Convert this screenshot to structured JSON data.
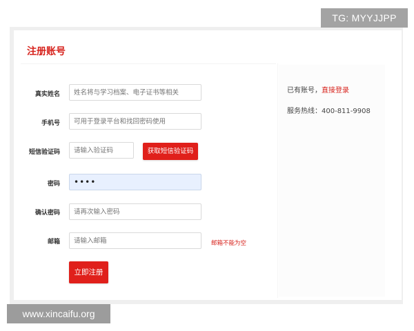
{
  "watermarks": {
    "top_right": "TG: MYYJJPP",
    "bottom_left": "www.xincaifu.org"
  },
  "form": {
    "title": "注册账号",
    "fields": {
      "real_name": {
        "label": "真实姓名",
        "placeholder": "姓名将与学习档案、电子证书等相关",
        "value": ""
      },
      "phone": {
        "label": "手机号",
        "placeholder": "可用于登录平台和找回密码使用",
        "value": ""
      },
      "sms_code": {
        "label": "短信验证码",
        "placeholder": "请输入验证码",
        "value": "",
        "button_label": "获取短信验证码"
      },
      "password": {
        "label": "密码",
        "placeholder": "",
        "value": "••••"
      },
      "confirm_password": {
        "label": "确认密码",
        "placeholder": "请再次输入密码",
        "value": ""
      },
      "email": {
        "label": "邮箱",
        "placeholder": "请输入邮箱",
        "value": "",
        "error": "邮箱不能为空"
      }
    },
    "submit_label": "立即注册"
  },
  "side": {
    "have_account": "已有账号，",
    "login_link": "直接登录",
    "hotline_label": "服务热线：",
    "hotline_number": "400-811-9908"
  },
  "colors": {
    "accent": "#e0201b",
    "autofill": "#e8f0fe"
  }
}
